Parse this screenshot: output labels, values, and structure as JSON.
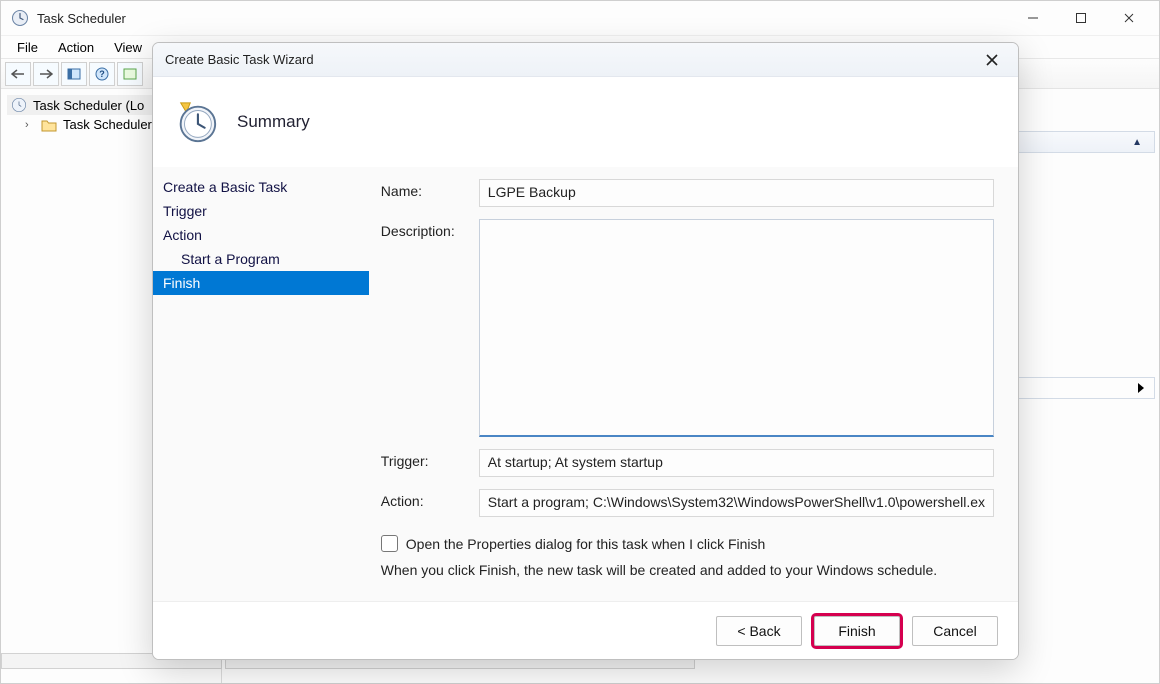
{
  "main_window": {
    "title": "Task Scheduler",
    "menus": [
      "File",
      "Action",
      "View"
    ],
    "tree": {
      "root": "Task Scheduler (Lo",
      "child": "Task Scheduler"
    }
  },
  "dialog": {
    "title": "Create Basic Task Wizard",
    "section_title": "Summary",
    "steps": {
      "create": "Create a Basic Task",
      "trigger": "Trigger",
      "action": "Action",
      "start_program": "Start a Program",
      "finish": "Finish"
    },
    "form": {
      "name_label": "Name:",
      "name_value": "LGPE Backup",
      "desc_label": "Description:",
      "desc_value": "",
      "trigger_label": "Trigger:",
      "trigger_value": "At startup; At system startup",
      "action_label": "Action:",
      "action_value": "Start a program; C:\\Windows\\System32\\WindowsPowerShell\\v1.0\\powershell.ex",
      "checkbox_label": "Open the Properties dialog for this task when I click Finish",
      "note": "When you click Finish, the new task will be created and added to your Windows schedule."
    },
    "buttons": {
      "back": "< Back",
      "finish": "Finish",
      "cancel": "Cancel"
    }
  }
}
